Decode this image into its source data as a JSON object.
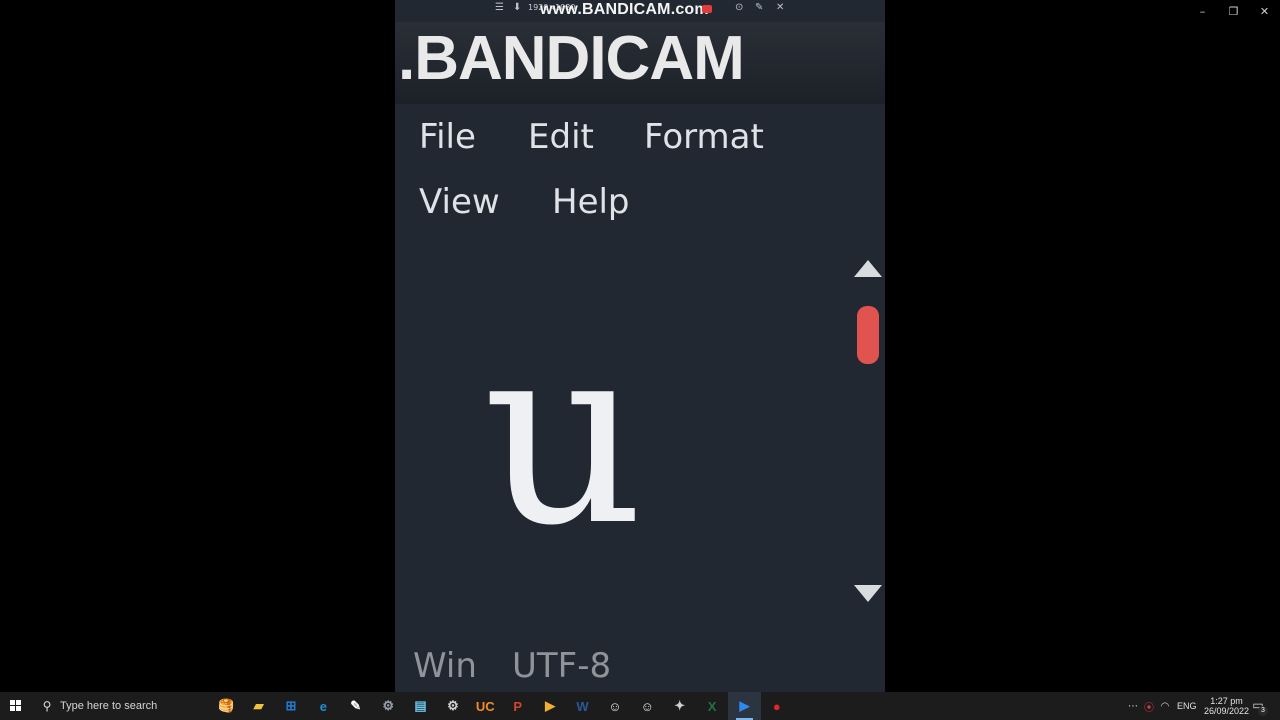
{
  "window_controls": {
    "minimize_icon": "minimize-icon",
    "restore_icon": "restore-icon",
    "close_icon": "close-icon",
    "minimize_glyph": "–",
    "restore_glyph": "❐",
    "close_glyph": "✕"
  },
  "watermark": {
    "resolution": "1920×1080",
    "url": "www.BANDICAM.com",
    "big_text": ".BANDICAM"
  },
  "notepad": {
    "menu": [
      "File",
      "Edit",
      "Format",
      "View",
      "Help"
    ],
    "content": "u",
    "status": {
      "line_ending": "Win",
      "encoding": "UTF-8"
    },
    "scroll_thumb_color": "#e0534f"
  },
  "taskbar": {
    "search_placeholder": "Type here to search",
    "apps": [
      {
        "name": "pancake-app-icon",
        "glyph": "🥞",
        "color": "#f0a030"
      },
      {
        "name": "file-explorer-icon",
        "glyph": "▰",
        "color": "#f2c23b"
      },
      {
        "name": "store-icon",
        "glyph": "⊞",
        "color": "#1f7ad6"
      },
      {
        "name": "edge-browser-icon",
        "glyph": "e",
        "color": "#1e8fd6"
      },
      {
        "name": "pen-app-icon",
        "glyph": "✎",
        "color": "#ffffff"
      },
      {
        "name": "gear-wheel-app-icon",
        "glyph": "⚙",
        "color": "#9aa0a8"
      },
      {
        "name": "notepad-app-icon",
        "glyph": "▤",
        "color": "#6bc5e8"
      },
      {
        "name": "settings-icon",
        "glyph": "⚙",
        "color": "#d0d0d0"
      },
      {
        "name": "uc-browser-icon",
        "glyph": "UC",
        "color": "#f28c28"
      },
      {
        "name": "powerpoint-icon",
        "glyph": "P",
        "color": "#d24726"
      },
      {
        "name": "media-player-icon",
        "glyph": "▶",
        "color": "#f2b12c"
      },
      {
        "name": "word-icon",
        "glyph": "W",
        "color": "#2b579a"
      },
      {
        "name": "penguin-app-icon",
        "glyph": "☺",
        "color": "#e8e8e8"
      },
      {
        "name": "penguin-app-2-icon",
        "glyph": "☺",
        "color": "#e8e8e8"
      },
      {
        "name": "figure-app-icon",
        "glyph": "✦",
        "color": "#cfcfcf"
      },
      {
        "name": "excel-icon",
        "glyph": "X",
        "color": "#217346"
      },
      {
        "name": "video-editor-icon",
        "glyph": "▶",
        "color": "#2d89ef"
      },
      {
        "name": "bandicam-record-icon",
        "glyph": "●",
        "color": "#e02626"
      }
    ],
    "active_app_index": 16,
    "tray": {
      "overflow_glyph": "⋯",
      "language": "ENG",
      "time": "1:27 pm",
      "date": "26/09/2022",
      "notification_count": "3"
    }
  }
}
